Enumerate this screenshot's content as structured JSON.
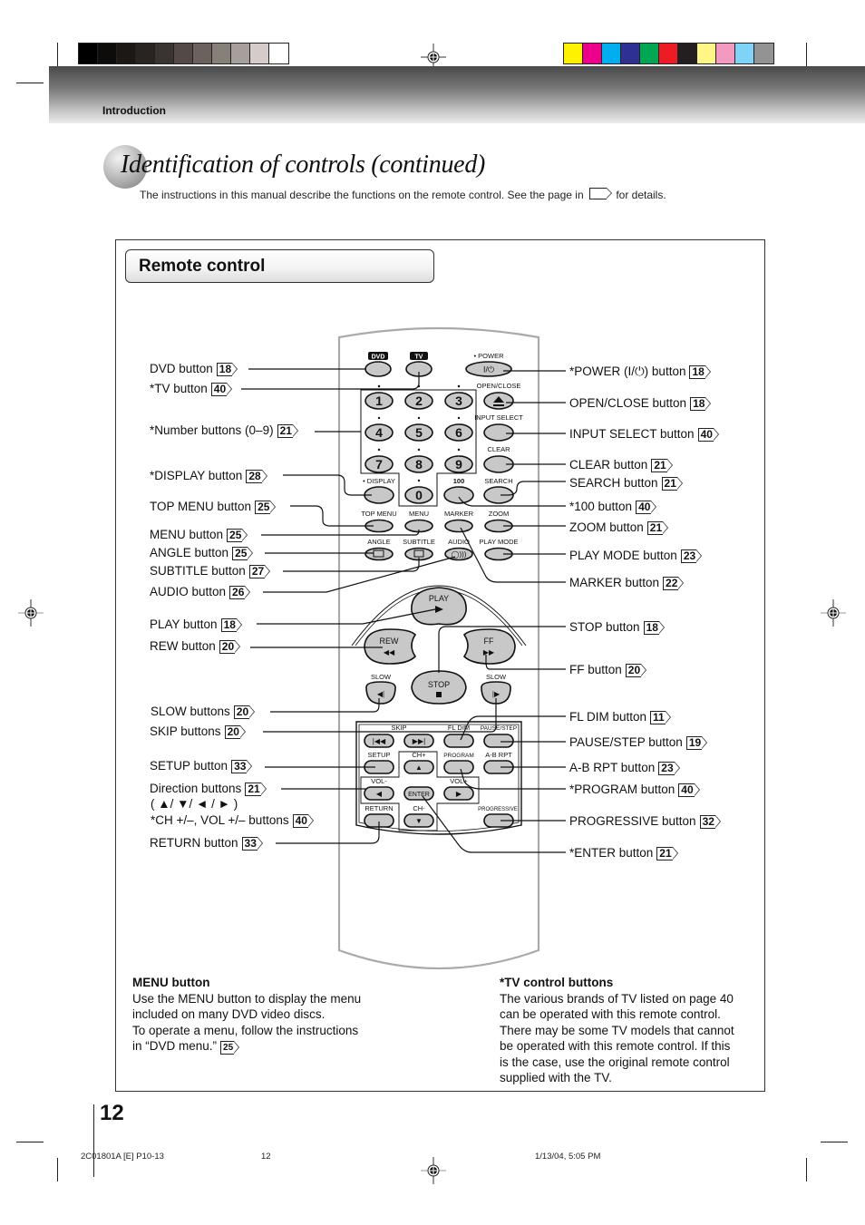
{
  "header": {
    "section": "Introduction",
    "grayscale_swatches": [
      "#000000",
      "#0e0c0b",
      "#1c1816",
      "#2a2421",
      "#3b3330",
      "#534946",
      "#6b615d",
      "#878079",
      "#a79f9b",
      "#d5cbc9",
      "#ffffff"
    ],
    "color_swatches": [
      "#fff200",
      "#ec008c",
      "#00aeef",
      "#2e3192",
      "#00a651",
      "#ed1c24",
      "#231f20",
      "#fff685",
      "#f49ac1",
      "#7fd3f7",
      "#939393"
    ]
  },
  "title": "Identification of controls (continued)",
  "intro": {
    "before": "The instructions in this manual describe the functions on the remote control. See the page in",
    "after": "for details."
  },
  "section_heading": "Remote control",
  "left_labels": [
    {
      "text": "DVD button",
      "page": "18"
    },
    {
      "text": "*TV button",
      "page": "40"
    },
    {
      "text": "*Number buttons (0–9)",
      "page": "21"
    },
    {
      "text": "*DISPLAY button",
      "page": "28"
    },
    {
      "text": "TOP MENU button",
      "page": "25"
    },
    {
      "text": "MENU button",
      "page": "25"
    },
    {
      "text": "ANGLE button",
      "page": "25"
    },
    {
      "text": "SUBTITLE button",
      "page": "27"
    },
    {
      "text": "AUDIO button",
      "page": "26"
    },
    {
      "text": "PLAY button",
      "page": "18"
    },
    {
      "text": "REW button",
      "page": "20"
    },
    {
      "text": "SLOW buttons",
      "page": "20"
    },
    {
      "text": "SKIP buttons",
      "page": "20"
    },
    {
      "text": "SETUP button",
      "page": "33"
    },
    {
      "text": "Direction buttons",
      "page": "21"
    },
    {
      "text": "( ▲/ ▼/ ◄ / ► )",
      "page": ""
    },
    {
      "text": "*CH +/–, VOL +/– buttons",
      "page": "40"
    },
    {
      "text": "RETURN button",
      "page": "33"
    }
  ],
  "right_labels": [
    {
      "text": "*POWER (I/⏻) button",
      "page": "18"
    },
    {
      "text": "OPEN/CLOSE button",
      "page": "18"
    },
    {
      "text": "INPUT SELECT button",
      "page": "40"
    },
    {
      "text": "CLEAR button",
      "page": "21"
    },
    {
      "text": "SEARCH button",
      "page": "21"
    },
    {
      "text": "*100 button",
      "page": "40"
    },
    {
      "text": "ZOOM button",
      "page": "21"
    },
    {
      "text": "PLAY MODE button",
      "page": "23"
    },
    {
      "text": "MARKER button",
      "page": "22"
    },
    {
      "text": "STOP button",
      "page": "18"
    },
    {
      "text": "FF button",
      "page": "20"
    },
    {
      "text": "FL DIM button",
      "page": "11"
    },
    {
      "text": "PAUSE/STEP button",
      "page": "19"
    },
    {
      "text": "A-B RPT button",
      "page": "23"
    },
    {
      "text": "*PROGRAM button",
      "page": "40"
    },
    {
      "text": "PROGRESSIVE button",
      "page": "32"
    },
    {
      "text": "*ENTER button",
      "page": "21"
    }
  ],
  "remote": {
    "dvd": "DVD",
    "tv": "TV",
    "power": "• POWER",
    "power_glyph": "I/⏻",
    "open_close": "OPEN/CLOSE",
    "input_select": "INPUT SELECT",
    "clear": "CLEAR",
    "display": "• DISPLAY",
    "hundred": "100",
    "search": "SEARCH",
    "digits": [
      "1",
      "2",
      "3",
      "4",
      "5",
      "6",
      "7",
      "8",
      "9",
      "0"
    ],
    "top_menu": "TOP MENU",
    "menu": "MENU",
    "marker": "MARKER",
    "zoom": "ZOOM",
    "angle": "ANGLE",
    "subtitle": "SUBTITLE",
    "audio": "AUDIO",
    "play_mode": "PLAY MODE",
    "play": "PLAY",
    "rew": "REW",
    "ff": "FF",
    "stop": "STOP",
    "slow": "SLOW",
    "skip": "SKIP",
    "fl_dim": "FL DIM",
    "pause_step": "PAUSE/STEP",
    "setup": "SETUP",
    "ch_plus": "CH+",
    "program": "PROGRAM",
    "ab_rpt": "A-B RPT",
    "vol_minus": "VOL-",
    "enter": "ENTER",
    "vol_plus": "VOL+",
    "return": "RETURN",
    "ch_minus": "CH-",
    "progressive": "PROGRESSIVE"
  },
  "notes": {
    "menu": {
      "title": "MENU button",
      "lines": [
        "Use the MENU button to display the menu",
        "included on many DVD video discs.",
        "To operate a menu, follow the instructions",
        "in “DVD menu.”"
      ],
      "page": "25"
    },
    "tv": {
      "title": "*TV control buttons",
      "lines": [
        "The various brands of TV listed on page 40",
        "can be operated with this remote control.",
        "There may be some TV models that cannot",
        "be operated with this remote control. If this",
        "is the case, use the original remote control",
        "supplied with the TV."
      ]
    }
  },
  "page_number": "12",
  "footer": {
    "job": "2C01801A [E] P10-13",
    "page": "12",
    "datetime": "1/13/04, 5:05 PM"
  }
}
